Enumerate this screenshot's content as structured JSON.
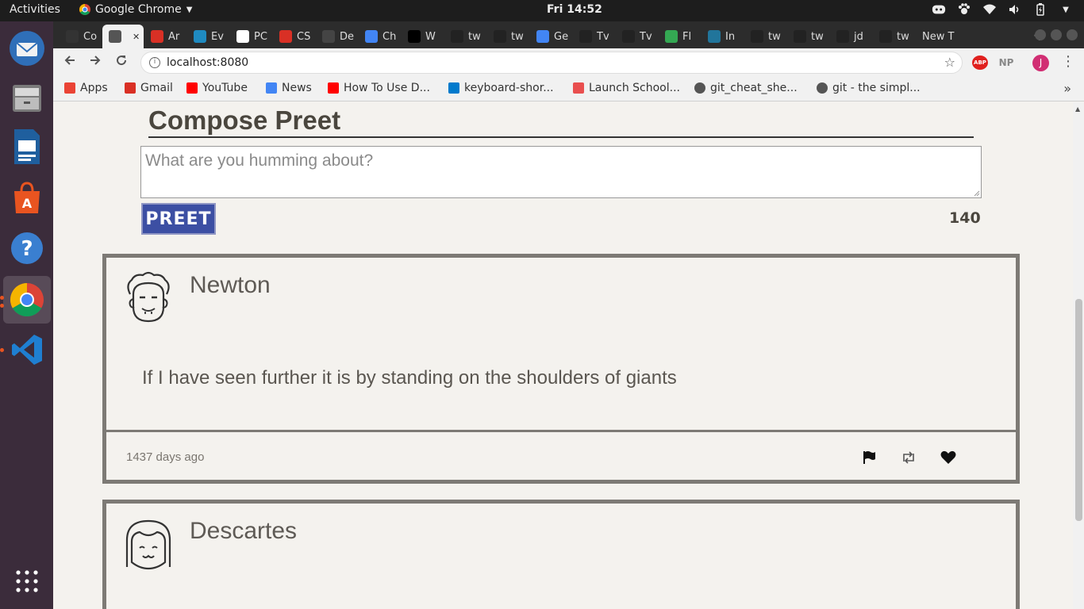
{
  "system": {
    "activities": "Activities",
    "app_name": "Google Chrome",
    "clock": "Fri 14:52"
  },
  "browser": {
    "tabs": [
      {
        "label": "Co",
        "icon": "add-circle-icon",
        "color": "#333333"
      },
      {
        "label": "",
        "icon": "globe-icon",
        "color": "#555555",
        "active": true
      },
      {
        "label": "Ar",
        "icon": "scribd-icon",
        "color": "#d93025"
      },
      {
        "label": "Ev",
        "icon": "evernote-icon",
        "color": "#1f8ac0"
      },
      {
        "label": "PC",
        "icon": "wikipedia-icon",
        "color": "#ffffff"
      },
      {
        "label": "CS",
        "icon": "scribd-icon",
        "color": "#d93025"
      },
      {
        "label": "De",
        "icon": "code-icon",
        "color": "#444444"
      },
      {
        "label": "Ch",
        "icon": "google-icon",
        "color": "#4285f4"
      },
      {
        "label": "W",
        "icon": "medium-icon",
        "color": "#000000"
      },
      {
        "label": "tw",
        "icon": "github-icon",
        "color": "#222222"
      },
      {
        "label": "tw",
        "icon": "github-icon",
        "color": "#222222"
      },
      {
        "label": "Ge",
        "icon": "google-icon",
        "color": "#4285f4"
      },
      {
        "label": "Tv",
        "icon": "github-icon",
        "color": "#222222"
      },
      {
        "label": "Tv",
        "icon": "github-icon",
        "color": "#222222"
      },
      {
        "label": "Fl",
        "icon": "frog-icon",
        "color": "#34a853"
      },
      {
        "label": "In",
        "icon": "wordpress-icon",
        "color": "#21759b"
      },
      {
        "label": "tw",
        "icon": "github-icon",
        "color": "#222222"
      },
      {
        "label": "tw",
        "icon": "github-icon",
        "color": "#222222"
      },
      {
        "label": "jd",
        "icon": "github-icon",
        "color": "#222222"
      },
      {
        "label": "tw",
        "icon": "github-icon",
        "color": "#222222"
      },
      {
        "label": "New T",
        "icon": "",
        "color": ""
      }
    ],
    "url": "localhost:8080",
    "extensions": [
      "ABP",
      "NP"
    ],
    "profile_initial": "J",
    "bookmarks": [
      {
        "label": "Apps",
        "icon": "apps-grid-icon",
        "color": "#ea4335"
      },
      {
        "label": "Gmail",
        "icon": "gmail-icon",
        "color": "#d93025"
      },
      {
        "label": "YouTube",
        "icon": "youtube-icon",
        "color": "#ff0000"
      },
      {
        "label": "News",
        "icon": "news-icon",
        "color": "#4285f4"
      },
      {
        "label": "How To Use D...",
        "icon": "youtube-icon",
        "color": "#ff0000"
      },
      {
        "label": "keyboard-shor...",
        "icon": "vscode-icon",
        "color": "#007acc"
      },
      {
        "label": "Launch School...",
        "icon": "launch-school-icon",
        "color": "#e94f4f"
      },
      {
        "label": "git_cheat_she...",
        "icon": "globe-icon",
        "color": "#555555"
      },
      {
        "label": "git - the simpl...",
        "icon": "globe-icon",
        "color": "#555555"
      }
    ]
  },
  "app": {
    "compose_title": "Compose Preet",
    "placeholder": "What are you humming about?",
    "submit_label": "PREET",
    "char_count": "140",
    "tweets": [
      {
        "name": "Newton",
        "text": "If I have seen further it is by standing on the shoulders of giants",
        "age": "1437 days ago"
      },
      {
        "name": "Descartes",
        "text": "",
        "age": ""
      }
    ]
  },
  "colors": {
    "accent": "#3c4fa3",
    "page_bg": "#f4f2ee",
    "border": "#7d7a75",
    "dock_bg": "#3b2c3b"
  }
}
